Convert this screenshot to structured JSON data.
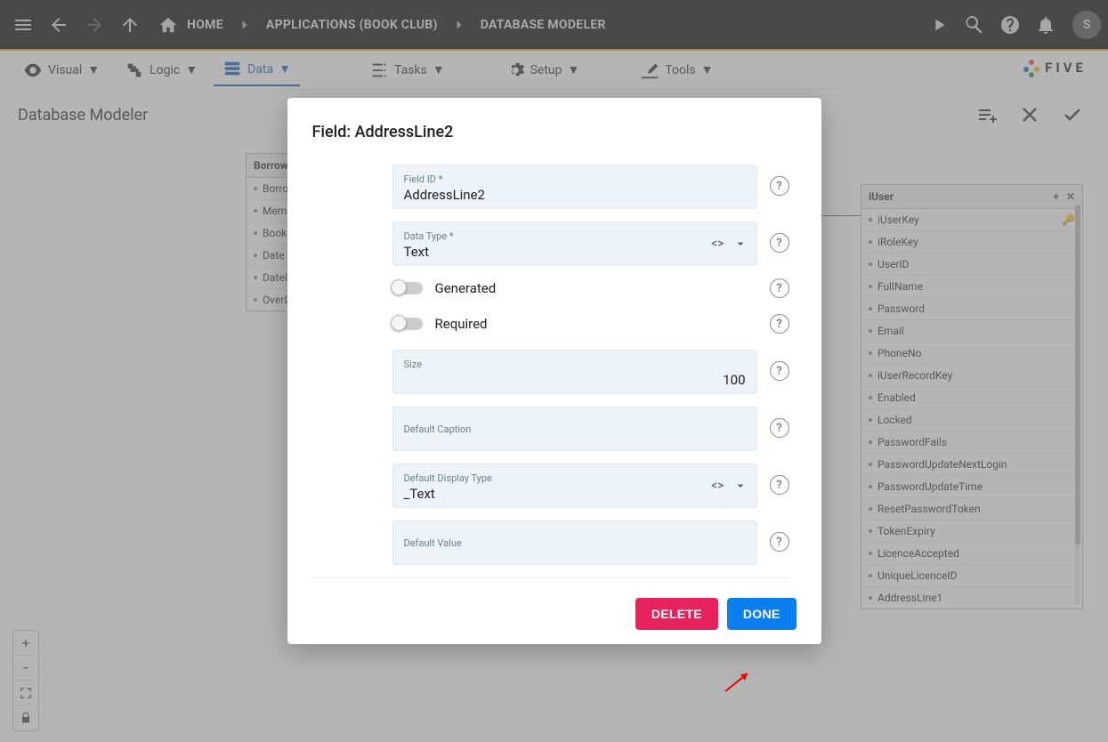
{
  "topbar": {
    "home_label": "HOME",
    "crumb1": "APPLICATIONS (BOOK CLUB)",
    "crumb2": "DATABASE MODELER",
    "avatar_initial": "S"
  },
  "menubar": {
    "visual": "Visual",
    "logic": "Logic",
    "data": "Data",
    "tasks": "Tasks",
    "setup": "Setup",
    "tools": "Tools",
    "logo": "FIVE"
  },
  "page": {
    "title": "Database Modeler"
  },
  "tables": {
    "borrow": {
      "name": "Borrow",
      "fields": [
        "BorrowH",
        "Member",
        "BookKey",
        "Date",
        "DateRetu",
        "OverDue"
      ]
    },
    "iuser": {
      "name": "iUser",
      "fields": [
        "iUserKey",
        "iRoleKey",
        "UserID",
        "FullName",
        "Password",
        "Email",
        "PhoneNo",
        "iUserRecordKey",
        "Enabled",
        "Locked",
        "PasswordFails",
        "PasswordUpdateNextLogin",
        "PasswordUpdateTime",
        "ResetPasswordToken",
        "TokenExpiry",
        "LicenceAccepted",
        "UniqueLicenceID",
        "AddressLine1"
      ]
    }
  },
  "modal": {
    "title": "Field: AddressLine2",
    "field_id_label": "Field ID *",
    "field_id_value": "AddressLine2",
    "datatype_label": "Data Type *",
    "datatype_value": "Text",
    "generated_label": "Generated",
    "required_label": "Required",
    "size_label": "Size",
    "size_value": "100",
    "default_caption_label": "Default Caption",
    "default_caption_value": "",
    "default_display_type_label": "Default Display Type",
    "default_display_type_value": "_Text",
    "default_value_label": "Default Value",
    "default_value_value": "",
    "delete_label": "DELETE",
    "done_label": "DONE"
  }
}
